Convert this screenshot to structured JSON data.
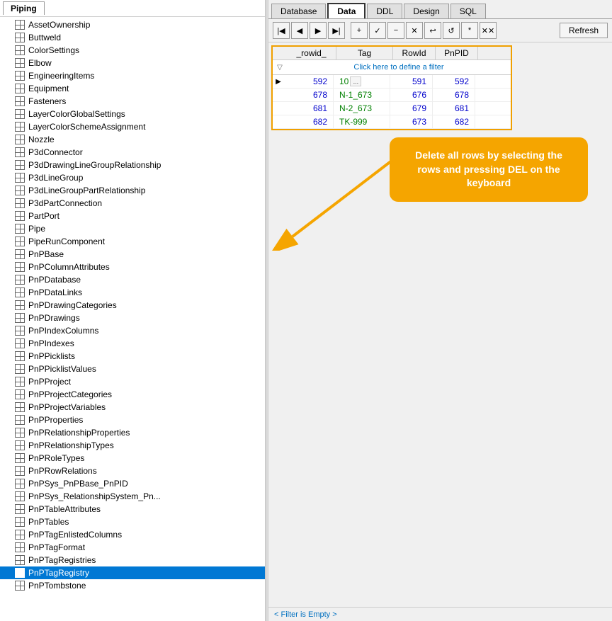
{
  "left_panel": {
    "piping_tab_label": "Piping",
    "tree_items": [
      {
        "id": "asset-ownership",
        "label": "AssetOwnership",
        "selected": false
      },
      {
        "id": "buttweld",
        "label": "Buttweld",
        "selected": false
      },
      {
        "id": "color-settings",
        "label": "ColorSettings",
        "selected": false
      },
      {
        "id": "elbow",
        "label": "Elbow",
        "selected": false
      },
      {
        "id": "engineering-items",
        "label": "EngineeringItems",
        "selected": false
      },
      {
        "id": "equipment",
        "label": "Equipment",
        "selected": false
      },
      {
        "id": "fasteners",
        "label": "Fasteners",
        "selected": false
      },
      {
        "id": "layer-color-global",
        "label": "LayerColorGlobalSettings",
        "selected": false
      },
      {
        "id": "layer-color-scheme",
        "label": "LayerColorSchemeAssignment",
        "selected": false
      },
      {
        "id": "nozzle",
        "label": "Nozzle",
        "selected": false
      },
      {
        "id": "p3d-connector",
        "label": "P3dConnector",
        "selected": false
      },
      {
        "id": "p3d-drawing-line",
        "label": "P3dDrawingLineGroupRelationship",
        "selected": false
      },
      {
        "id": "p3d-line-group",
        "label": "P3dLineGroup",
        "selected": false
      },
      {
        "id": "p3d-line-group-part",
        "label": "P3dLineGroupPartRelationship",
        "selected": false
      },
      {
        "id": "p3d-part-connection",
        "label": "P3dPartConnection",
        "selected": false
      },
      {
        "id": "part-port",
        "label": "PartPort",
        "selected": false
      },
      {
        "id": "pipe",
        "label": "Pipe",
        "selected": false
      },
      {
        "id": "pipe-run-component",
        "label": "PipeRunComponent",
        "selected": false
      },
      {
        "id": "pnp-base",
        "label": "PnPBase",
        "selected": false
      },
      {
        "id": "pnp-column-attributes",
        "label": "PnPColumnAttributes",
        "selected": false
      },
      {
        "id": "pnp-database",
        "label": "PnPDatabase",
        "selected": false
      },
      {
        "id": "pnp-data-links",
        "label": "PnPDataLinks",
        "selected": false
      },
      {
        "id": "pnp-drawing-categories",
        "label": "PnPDrawingCategories",
        "selected": false
      },
      {
        "id": "pnp-drawings",
        "label": "PnPDrawings",
        "selected": false
      },
      {
        "id": "pnp-index-columns",
        "label": "PnPIndexColumns",
        "selected": false
      },
      {
        "id": "pnp-indexes",
        "label": "PnPIndexes",
        "selected": false
      },
      {
        "id": "pnp-picklists",
        "label": "PnPPicklists",
        "selected": false
      },
      {
        "id": "pnp-picklist-values",
        "label": "PnPPicklistValues",
        "selected": false
      },
      {
        "id": "pnp-project",
        "label": "PnPProject",
        "selected": false
      },
      {
        "id": "pnp-project-categories",
        "label": "PnPProjectCategories",
        "selected": false
      },
      {
        "id": "pnp-project-variables",
        "label": "PnPProjectVariables",
        "selected": false
      },
      {
        "id": "pnp-properties",
        "label": "PnPProperties",
        "selected": false
      },
      {
        "id": "pnp-relationship-properties",
        "label": "PnPRelationshipProperties",
        "selected": false
      },
      {
        "id": "pnp-relationship-types",
        "label": "PnPRelationshipTypes",
        "selected": false
      },
      {
        "id": "pnp-role-types",
        "label": "PnPRoleTypes",
        "selected": false
      },
      {
        "id": "pnp-row-relations",
        "label": "PnPRowRelations",
        "selected": false
      },
      {
        "id": "pnpsys-pnpbase-pnpid",
        "label": "PnPSys_PnPBase_PnPID",
        "selected": false
      },
      {
        "id": "pnpsys-relationship-system",
        "label": "PnPSys_RelationshipSystem_Pn...",
        "selected": false
      },
      {
        "id": "pnp-table-attributes",
        "label": "PnPTableAttributes",
        "selected": false
      },
      {
        "id": "pnp-tables",
        "label": "PnPTables",
        "selected": false
      },
      {
        "id": "pnp-tag-enlisted-columns",
        "label": "PnPTagEnlistedColumns",
        "selected": false
      },
      {
        "id": "pnp-tag-format",
        "label": "PnPTagFormat",
        "selected": false
      },
      {
        "id": "pnp-tag-registries",
        "label": "PnPTagRegistries",
        "selected": false
      },
      {
        "id": "pnp-tag-registry",
        "label": "PnPTagRegistry",
        "selected": true
      },
      {
        "id": "pnp-tombstone",
        "label": "PnPTombstone",
        "selected": false
      }
    ]
  },
  "right_panel": {
    "tabs": [
      {
        "id": "database",
        "label": "Database",
        "active": false
      },
      {
        "id": "data",
        "label": "Data",
        "active": true
      },
      {
        "id": "ddl",
        "label": "DDL",
        "active": false
      },
      {
        "id": "design",
        "label": "Design",
        "active": false
      },
      {
        "id": "sql",
        "label": "SQL",
        "active": false
      }
    ],
    "toolbar": {
      "refresh_label": "Refresh",
      "nav_buttons": [
        "◀◀",
        "◀",
        "▶",
        "▶▶",
        "+",
        "✓",
        "−",
        "✕",
        "↩",
        "↺",
        "*",
        "✕✕"
      ]
    },
    "grid": {
      "columns": [
        "_rowid_",
        "Tag",
        "RowId",
        "PnPID"
      ],
      "filter_placeholder": "Click here to define a filter",
      "rows": [
        {
          "rowid": "592",
          "tag": "10",
          "tag_dots": "...",
          "rowld": "591",
          "pnpid": "592"
        },
        {
          "rowid": "678",
          "tag": "N-1_673",
          "tag_dots": "",
          "rowld": "676",
          "pnpid": "678"
        },
        {
          "rowid": "681",
          "tag": "N-2_673",
          "tag_dots": "",
          "rowld": "679",
          "pnpid": "681"
        },
        {
          "rowid": "682",
          "tag": "TK-999",
          "tag_dots": "",
          "rowld": "673",
          "pnpid": "682"
        }
      ]
    },
    "tooltip": {
      "text": "Delete all rows by selecting the rows and pressing DEL on the keyboard"
    },
    "status_bar": {
      "text": "< Filter is Empty >"
    }
  }
}
